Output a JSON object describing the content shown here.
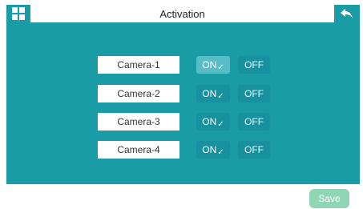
{
  "header": {
    "title": "Activation",
    "menu_icon": "grid-menu-icon",
    "back_icon": "back-arrow-icon"
  },
  "cameras": [
    {
      "label": "Camera-1",
      "on_label": "ON",
      "off_label": "OFF",
      "state": "on",
      "selected": true
    },
    {
      "label": "Camera-2",
      "on_label": "ON",
      "off_label": "OFF",
      "state": "on",
      "selected": false
    },
    {
      "label": "Camera-3",
      "on_label": "ON",
      "off_label": "OFF",
      "state": "on",
      "selected": false
    },
    {
      "label": "Camera-4",
      "on_label": "ON",
      "off_label": "OFF",
      "state": "on",
      "selected": false
    }
  ],
  "footer": {
    "save_label": "Save"
  },
  "colors": {
    "teal": "#1a9ca6",
    "selected_button": "#58bcc4",
    "save_button": "#8fd6b5"
  }
}
